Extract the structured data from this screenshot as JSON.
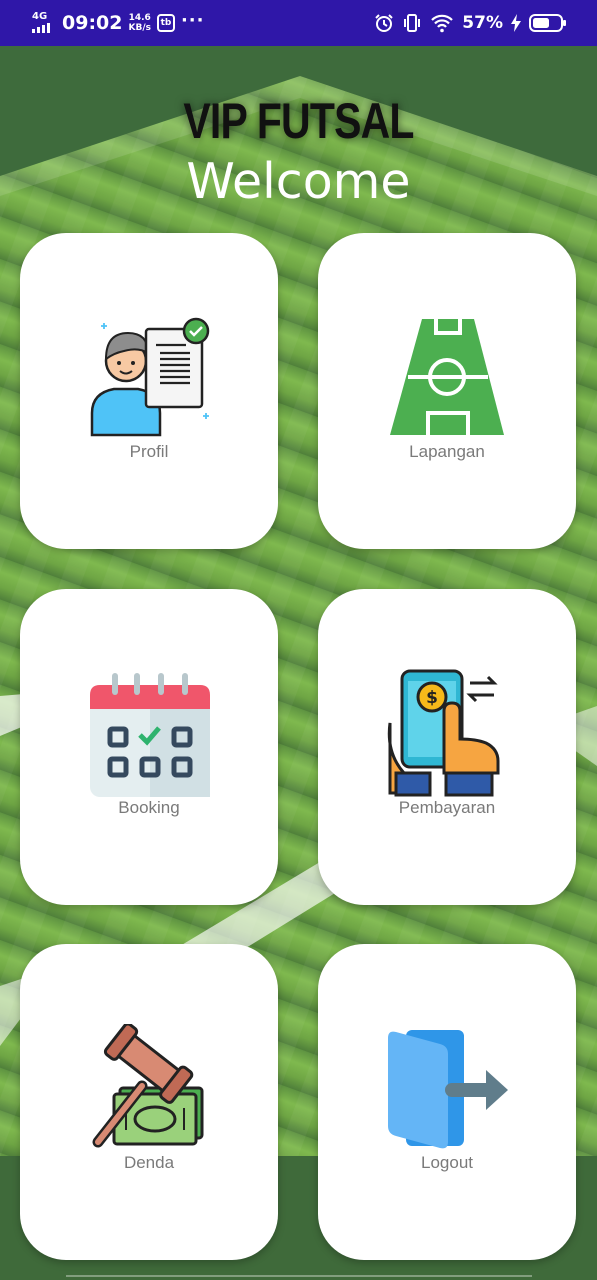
{
  "status_bar": {
    "network": "4G",
    "time": "09:02",
    "speed_value": "14.6",
    "speed_unit": "KB/s",
    "app_badge": "tb",
    "more": "···",
    "battery_percent": "57%",
    "bar_color": "#2f17a8"
  },
  "header": {
    "brand": "VIP FUTSAL",
    "welcome": "Welcome"
  },
  "menu": [
    {
      "label": "Profil",
      "icon": "profile-document-icon"
    },
    {
      "label": "Lapangan",
      "icon": "futsal-field-icon"
    },
    {
      "label": "Booking",
      "icon": "calendar-icon"
    },
    {
      "label": "Pembayaran",
      "icon": "mobile-payment-icon"
    },
    {
      "label": "Denda",
      "icon": "gavel-money-icon"
    },
    {
      "label": "Logout",
      "icon": "logout-door-icon"
    }
  ],
  "colors": {
    "grass_light": "#7fb94e",
    "grass_dark": "#3e6b3c",
    "card": "#ffffff",
    "label": "#7a7a7a",
    "field_icon": "#4caf50",
    "logout_blue": "#64b5f6",
    "logout_arrow": "#607d8b"
  }
}
